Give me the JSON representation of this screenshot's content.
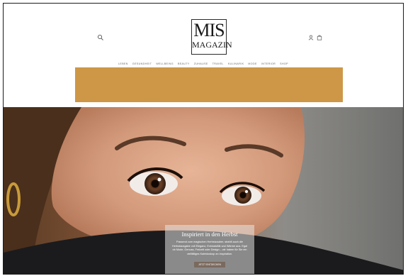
{
  "header": {
    "logo": {
      "line1": "MIS",
      "line2": "MAGAZIN"
    },
    "nav": [
      "LEBEN",
      "GESUNDHEIT",
      "WELLBEING",
      "BEAUTY",
      "ZUHAUSE",
      "TRAVEL",
      "KULINARIK",
      "MODE",
      "INTERIOR",
      "SHOP"
    ],
    "icons": [
      "search-icon",
      "account-icon",
      "cart-icon"
    ]
  },
  "banner": {
    "color": "#cd9747"
  },
  "hero": {
    "title": "Inspiriert in den Herbst",
    "description": "Passend zum magischen Herbstzauber, strahlt auch die Herbstausgabe voll Eleganz, Exklusivität und Wärme aus. Egal ob Mode, Genuss, Freizeit oder Design – wir haben für Sie ein vielfältiges Kaleidoskop an Inspiration.",
    "button_label": "JETZT ENTDECKEN"
  },
  "colors": {
    "accent": "#cd9747",
    "button": "#7a6a5e"
  }
}
